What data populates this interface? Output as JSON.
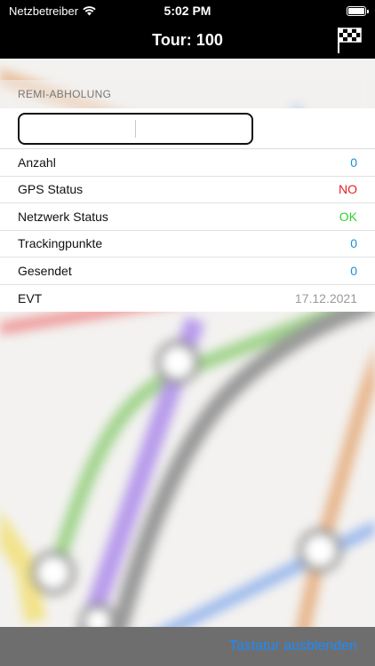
{
  "status_bar": {
    "carrier": "Netzbetreiber",
    "time": "5:02 PM"
  },
  "nav": {
    "title": "Tour: 100",
    "flag_icon": "checkered-flag-icon"
  },
  "section": {
    "header": "REMI-ABHOLUNG"
  },
  "input": {
    "value": "",
    "placeholder": ""
  },
  "rows": [
    {
      "label": "Anzahl",
      "value": "0",
      "color": "#1a8fd6"
    },
    {
      "label": "GPS Status",
      "value": "NO",
      "color": "#e6211e"
    },
    {
      "label": "Netzwerk Status",
      "value": "OK",
      "color": "#2fd12f"
    },
    {
      "label": "Trackingpunkte",
      "value": "0",
      "color": "#1a8fd6"
    },
    {
      "label": "Gesendet",
      "value": "0",
      "color": "#1a8fd6"
    },
    {
      "label": "EVT",
      "value": "17.12.2021",
      "color": "#9a9a9a"
    }
  ],
  "keyboard_bar": {
    "hide_label": "Tastatur ausblenden"
  }
}
